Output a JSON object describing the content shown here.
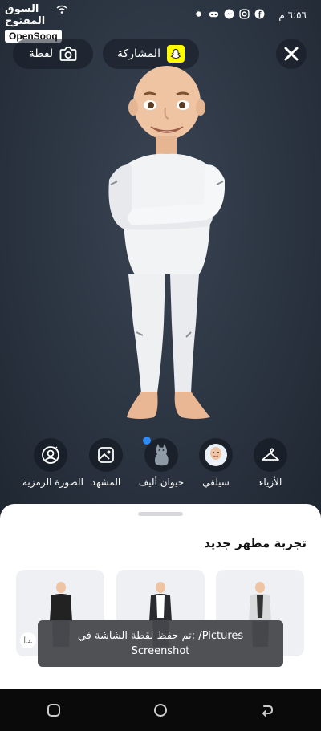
{
  "status_bar": {
    "time": "٦:٥٦ م"
  },
  "logo": {
    "arabic": "السوق المفتوح",
    "english": "OpenSooq"
  },
  "top_bar": {
    "snapshot_label": "لقطة",
    "share_label": "المشاركة"
  },
  "categories": [
    {
      "label": "الأزياء",
      "icon": "hanger-icon"
    },
    {
      "label": "سيلفي",
      "icon": "selfie-avatar-icon"
    },
    {
      "label": "حيوان أليف",
      "icon": "pet-cat-icon"
    },
    {
      "label": "المشهد",
      "icon": "scene-image-icon"
    },
    {
      "label": "الصورة الرمزية",
      "icon": "avatar-person-icon"
    }
  ],
  "sheet": {
    "title": "تجربة مظهر جديد",
    "card_badge": "د.أ."
  },
  "toast": {
    "line1": "تم حفظ لقطة الشاشة في: /Pictures",
    "line2": "Screenshot"
  },
  "colors": {
    "snap_yellow": "#fffc00",
    "notify_dot": "#2f8cf6",
    "stage": "#2b3441"
  }
}
